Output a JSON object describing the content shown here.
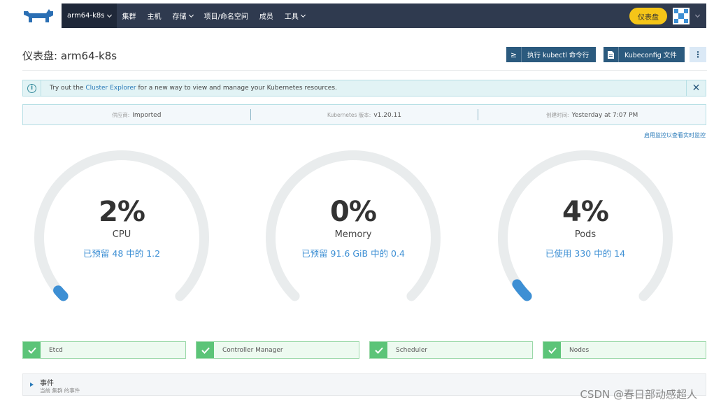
{
  "colors": {
    "nav_bg": "#2f3a4f",
    "accent_blue": "#3d8fd4",
    "dashboard_pill": "#f5c518",
    "ok_green": "#5cc478",
    "button_bg": "#2b5a7e"
  },
  "icons": {
    "logo": "rancher-cow-logo",
    "avatar": "user-avatar",
    "info": "info-icon",
    "close": "close-icon",
    "check": "check-icon"
  },
  "nav": {
    "cluster": "arm64-k8s",
    "items": [
      {
        "label": "集群",
        "dropdown": false
      },
      {
        "label": "主机",
        "dropdown": false
      },
      {
        "label": "存储",
        "dropdown": true
      },
      {
        "label": "项目/命名空间",
        "dropdown": false
      },
      {
        "label": "成员",
        "dropdown": false
      },
      {
        "label": "工具",
        "dropdown": true
      }
    ],
    "dashboard_pill": "仪表盘"
  },
  "header": {
    "title": "仪表盘: arm64-k8s",
    "kubectl_button": "执行 kubectl 命令行",
    "kubeconfig_button": "Kubeconfig 文件",
    "more_button": "⋮"
  },
  "banner": {
    "prefix": "Try out the",
    "link": "Cluster Explorer",
    "suffix": "for a new way to view and manage your Kubernetes resources."
  },
  "info": {
    "provider_label": "供应商:",
    "provider_value": "Imported",
    "k8s_label": "Kubernetes 版本:",
    "k8s_value": "v1.20.11",
    "created_label": "创建时间:",
    "created_value": "Yesterday at 7:07 PM"
  },
  "monitor_link": "启用监控以查看实时监控",
  "gauges": [
    {
      "name": "CPU",
      "percent_text": "2%",
      "percent": 2,
      "subtitle": "已预留 48 中的 1.2"
    },
    {
      "name": "Memory",
      "percent_text": "0%",
      "percent": 0,
      "subtitle": "已预留 91.6 GiB 中的 0.4"
    },
    {
      "name": "Pods",
      "percent_text": "4%",
      "percent": 4,
      "subtitle": "已使用 330 中的 14"
    }
  ],
  "components": [
    {
      "label": "Etcd"
    },
    {
      "label": "Controller Manager"
    },
    {
      "label": "Scheduler"
    },
    {
      "label": "Nodes"
    }
  ],
  "events": {
    "title": "事件",
    "subtitle": "当前 集群 的事件"
  },
  "watermark": "CSDN @春日部动感超人"
}
